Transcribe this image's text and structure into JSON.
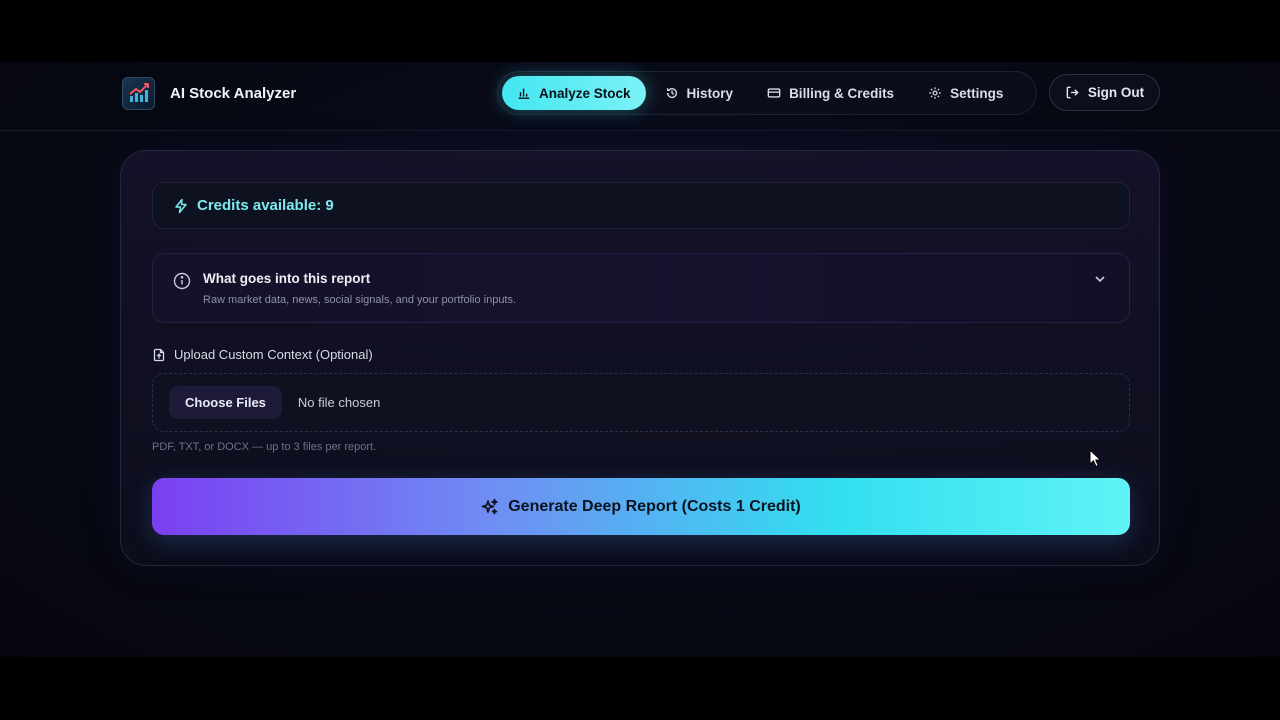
{
  "app": {
    "title": "AI Stock Analyzer"
  },
  "nav": {
    "items": [
      {
        "label": "Analyze Stock",
        "icon": "bar-chart-icon",
        "active": true
      },
      {
        "label": "History",
        "icon": "history-icon",
        "active": false
      },
      {
        "label": "Billing & Credits",
        "icon": "credit-card-icon",
        "active": false
      },
      {
        "label": "Settings",
        "icon": "gear-icon",
        "active": false
      }
    ],
    "sign_out_label": "Sign Out"
  },
  "credits": {
    "text": "Credits available: 9",
    "icon": "lightning-icon"
  },
  "info": {
    "title": "What goes into this report",
    "subtitle": "Raw market data, news, social signals, and your portfolio inputs."
  },
  "upload": {
    "label": "Upload Custom Context (Optional)",
    "button_label": "Choose Files",
    "status": "No file chosen",
    "hint": "PDF, TXT, or DOCX — up to 3 files per report."
  },
  "generate": {
    "label": "Generate Deep Report (Costs 1 Credit)",
    "icon": "sparkles-icon"
  },
  "colors": {
    "accent_cyan": "#43e6f0",
    "accent_purple": "#7b3ff2",
    "background": "#070914"
  }
}
